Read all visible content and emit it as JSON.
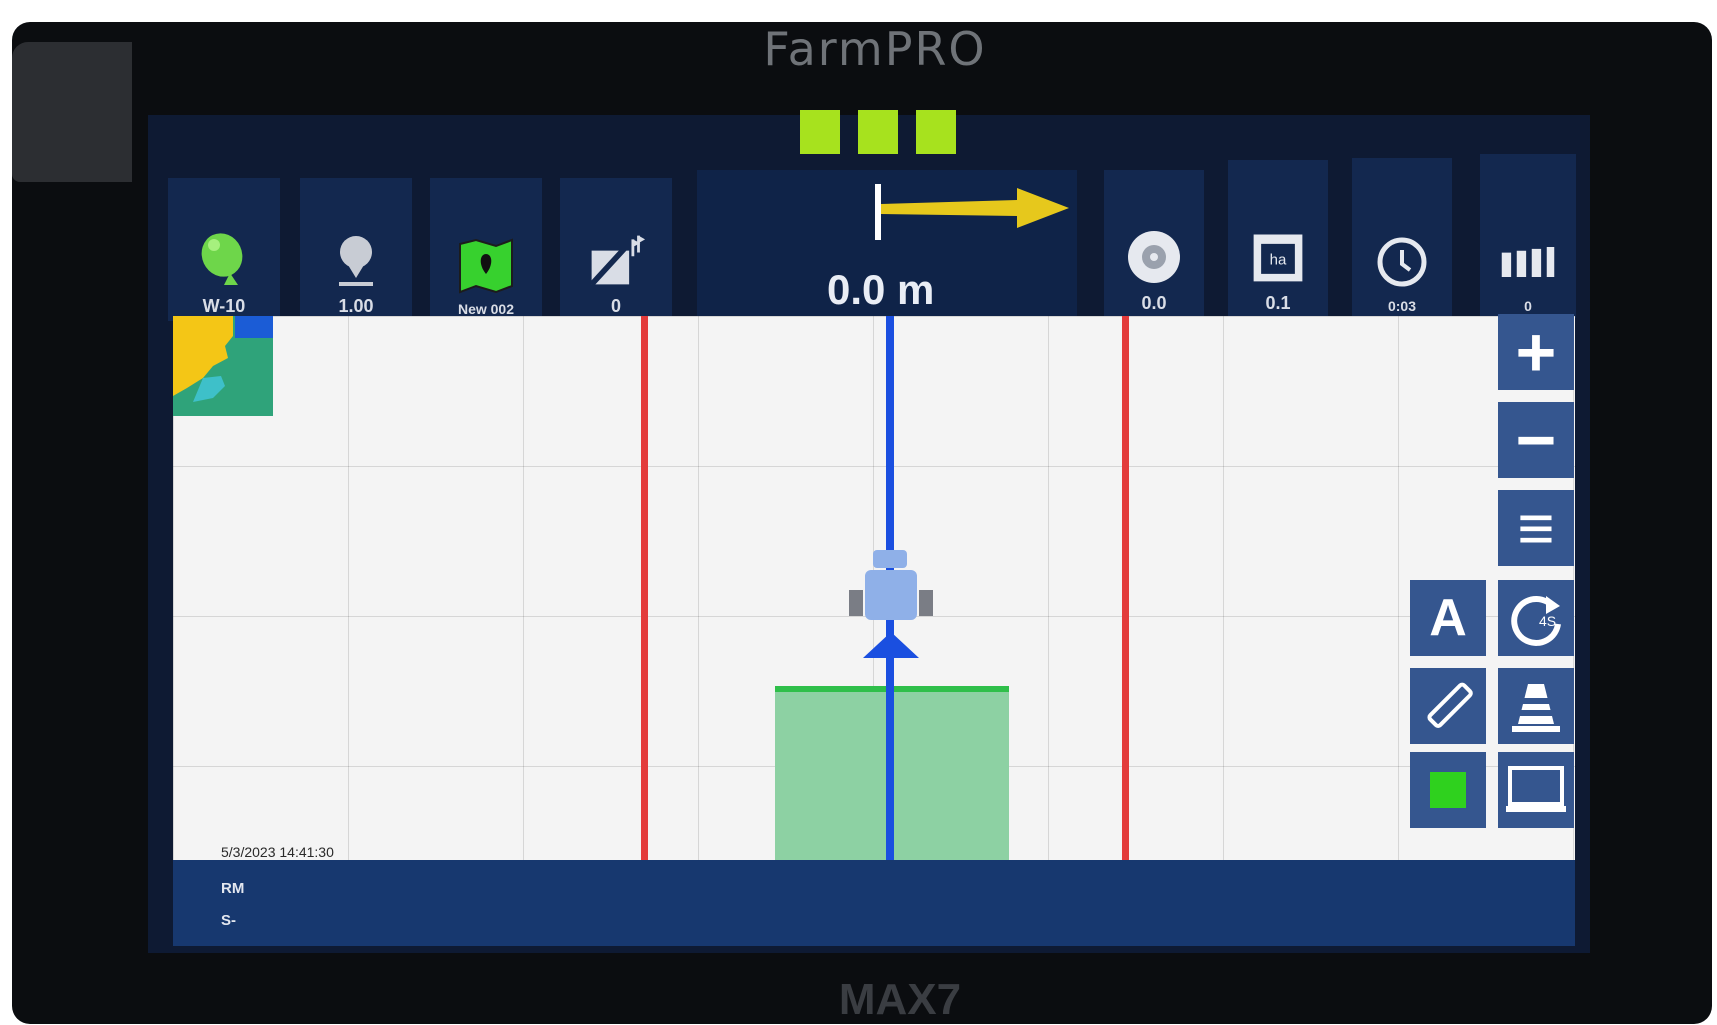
{
  "device": {
    "brand": "FarmPRO",
    "model": "MAX7"
  },
  "status_indicators": [
    "ok",
    "ok",
    "ok"
  ],
  "toolbar": {
    "gps": {
      "icon": "gps-satellite-icon",
      "label": "W-10"
    },
    "pin": {
      "icon": "location-pin-icon",
      "label": "1.00"
    },
    "field": {
      "icon": "field-map-icon",
      "label": "New 002"
    },
    "ab_line": {
      "icon": "ab-line-icon",
      "label": "0"
    },
    "speed": {
      "icon": "speedometer-icon",
      "label": "0.0"
    },
    "area": {
      "icon": "area-ha-icon",
      "label": "0.1",
      "unit": "ha"
    },
    "time": {
      "icon": "clock-icon",
      "label": "0:03"
    },
    "sections": {
      "icon": "sections-icon",
      "label": "0"
    }
  },
  "guidance": {
    "cross_track_error": "0.0 m"
  },
  "map": {
    "timestamp": "5/3/2023 14:41:30"
  },
  "side_buttons": {
    "zoom_in": "+",
    "zoom_out": "−",
    "menu": "≡",
    "auto": "A",
    "rotate": "4S"
  },
  "bottom_bar": {
    "line1": "RM",
    "line2": "S-"
  },
  "colors": {
    "boundary": "#e33b3b",
    "guidance_line": "#1a4fe0",
    "coverage": "#8dd1a3",
    "status_ok": "#a7e21e"
  }
}
